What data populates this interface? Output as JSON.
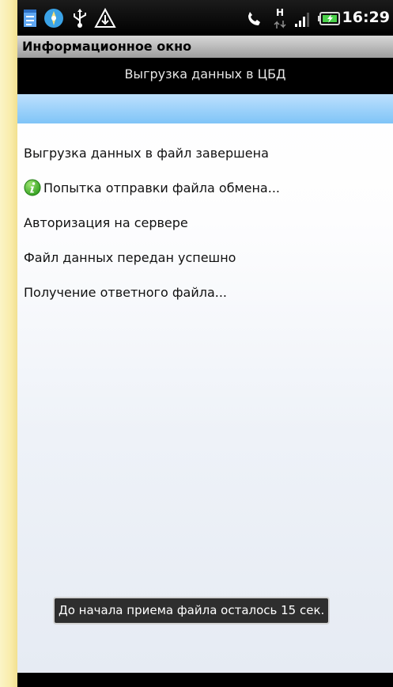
{
  "status_bar": {
    "time": "16:29",
    "network_type": "H",
    "icons": [
      "notes-icon",
      "app-icon",
      "usb-icon",
      "warning-icon",
      "phone-call-icon",
      "data-transfer-icon",
      "signal-icon",
      "battery-charging-icon"
    ]
  },
  "window": {
    "title": "Информационное окно"
  },
  "header": {
    "title": "Выгрузка данных в ЦБД"
  },
  "progress": {
    "indeterminate": true
  },
  "log": {
    "items": [
      {
        "text": "Выгрузка данных в файл завершена",
        "icon": ""
      },
      {
        "text": "Попытка отправки файла обмена...",
        "icon": "info-icon"
      },
      {
        "text": "Авторизация на сервере",
        "icon": ""
      },
      {
        "text": "Файл данных передан успешно",
        "icon": ""
      },
      {
        "text": "Получение ответного файла...",
        "icon": ""
      }
    ]
  },
  "toast": {
    "text": "До начала приема файла осталось 15 сек."
  },
  "colors": {
    "page_background": "#fbf2b8",
    "progress_band": "#9ed2fa",
    "info_icon": "#2fa81f"
  }
}
